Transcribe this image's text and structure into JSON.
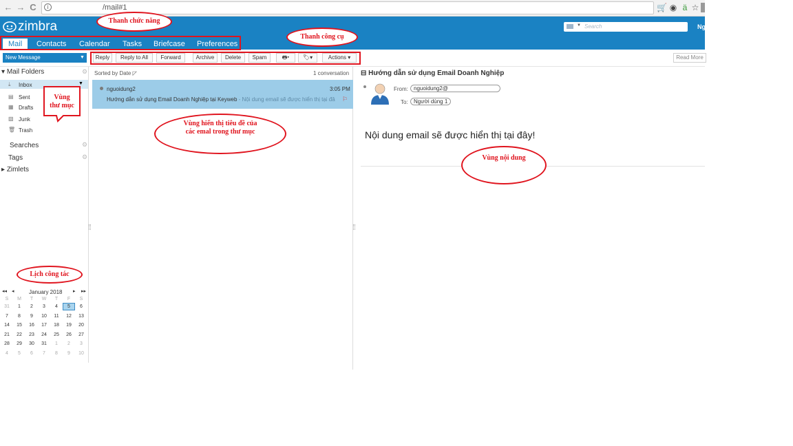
{
  "browser": {
    "url": "/mail#1",
    "nav": {
      "back": "←",
      "forward": "→",
      "reload": "C",
      "info": "i"
    },
    "ext_icons": [
      "🛒",
      "◉",
      "ä",
      "☆"
    ]
  },
  "app": {
    "logo": "zimbra",
    "search_placeholder": "Search",
    "user_name": "Ng",
    "tabs": [
      "Mail",
      "Contacts",
      "Calendar",
      "Tasks",
      "Briefcase",
      "Preferences"
    ]
  },
  "toolbar": {
    "new_message": "New Message",
    "buttons": [
      "Reply",
      "Reply to All",
      "Forward",
      "Archive",
      "Delete",
      "Spam",
      "Actions"
    ],
    "read_more": "Read More"
  },
  "sidebar": {
    "mail_folders": "Mail Folders",
    "folders": [
      "Inbox",
      "Sent",
      "Drafts",
      "Junk",
      "Trash"
    ],
    "searches": "Searches",
    "tags": "Tags",
    "zimlets": "Zimlets"
  },
  "calendar": {
    "month": "January 2018",
    "weekdays": [
      "S",
      "M",
      "T",
      "W",
      "T",
      "F",
      "S"
    ],
    "rows": [
      [
        "31",
        "1",
        "2",
        "3",
        "4",
        "5",
        "6"
      ],
      [
        "7",
        "8",
        "9",
        "10",
        "11",
        "12",
        "13"
      ],
      [
        "14",
        "15",
        "16",
        "17",
        "18",
        "19",
        "20"
      ],
      [
        "21",
        "22",
        "23",
        "24",
        "25",
        "26",
        "27"
      ],
      [
        "28",
        "29",
        "30",
        "31",
        "1",
        "2",
        "3"
      ],
      [
        "4",
        "5",
        "6",
        "7",
        "8",
        "9",
        "10"
      ]
    ],
    "selected": "5"
  },
  "message_list": {
    "sorted_by": "Sorted by Date",
    "count": "1 conversation",
    "items": [
      {
        "from": "nguoidung2",
        "time": "3:05 PM",
        "subject": "Hướng dẫn sử dụng Email Doanh Nghiệp tại Keyweb",
        "preview": "- Nội dung email sẽ được hiển thị tại đâ"
      }
    ]
  },
  "reading": {
    "title": "Hướng dẫn sử dụng Email Doanh Nghiệp",
    "from_label": "From:",
    "from": "nguoidung2@",
    "to_label": "To:",
    "to": "Người dùng 1",
    "body": "Nội dung email sẽ được hiển thị tại đây!"
  },
  "annotations": {
    "func_bar": "Thanh chức năng",
    "tool_bar": "Thanh công cụ",
    "folder_area_1": "Vùng",
    "folder_area_2": "thư mục",
    "list_area_1": "Vùng hiển thị tiêu đề của",
    "list_area_2": "các emal trong thư mục",
    "content_area": "Vùng nội dung",
    "calendar": "Lịch công tác"
  },
  "colors": {
    "brand": "#1a82c3",
    "annotation": "#e0141e",
    "selected_row": "#9ccce8"
  }
}
